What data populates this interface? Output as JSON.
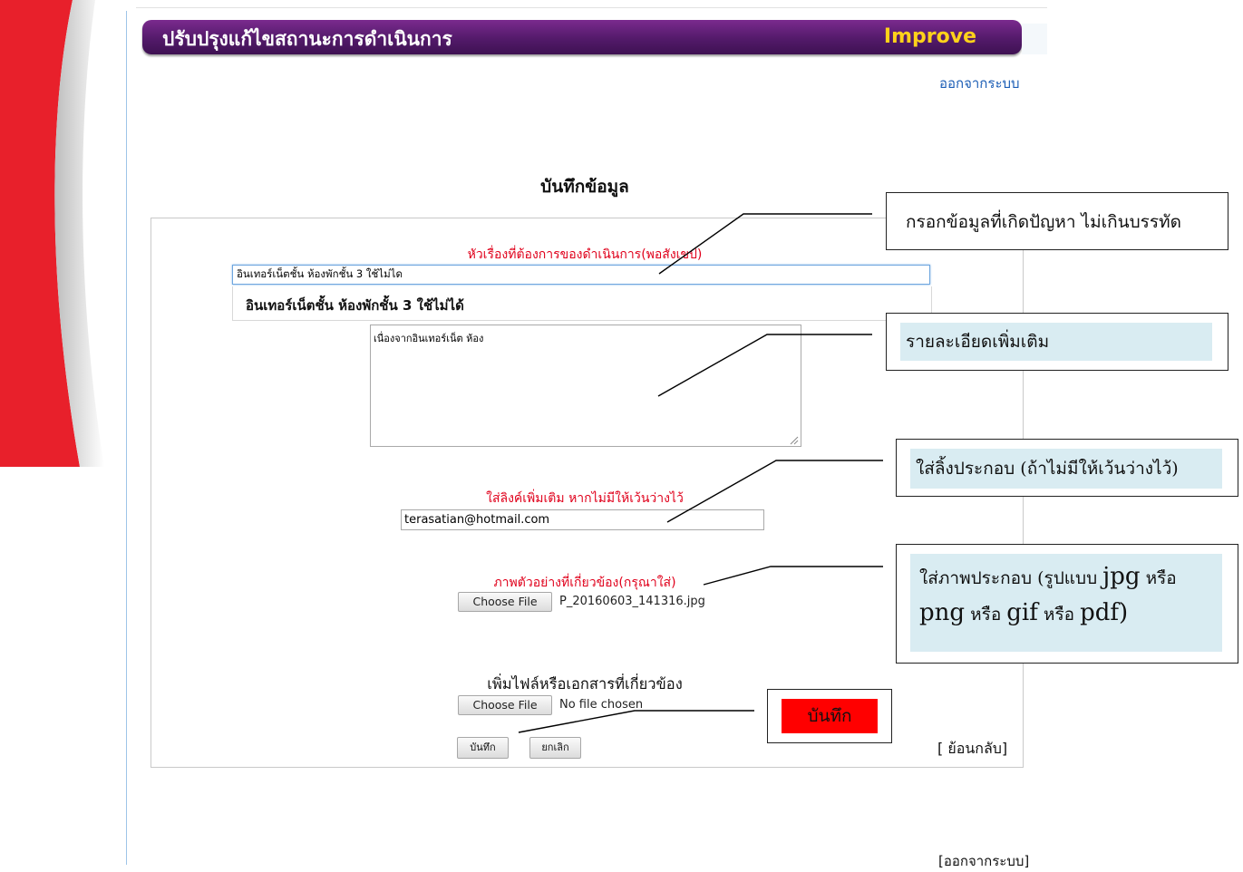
{
  "header": {
    "title_th": "ปรับปรุงแก้ไขสถานะการดำเนินการ",
    "title_en": "Improve",
    "logout_top": "ออกจากระบบ"
  },
  "form": {
    "heading": "บันทึกข้อมูล",
    "subject_label": "หัวเรื่องที่ต้องการของดำเนินการ(พอสังเขป)",
    "subject_value": "อินเทอร์เน็ตชั้น ห้องพักชั้น 3 ใช้ไม่ได",
    "subject_suggestion": "อินเทอร์เน็ตชั้น ห้องพักชั้น 3 ใช้ไม่ได้",
    "detail_value": "เนื่องจากอินเทอร์เน็ต ห้อง",
    "link_label": "ใส่ลิงค์เพิ่มเติม หากไม่มีให้เว้นว่างไว้",
    "link_value": "terasatian@hotmail.com",
    "image_label": "ภาพตัวอย่างที่เกี่ยวข้อง(กรุณาใส่)",
    "image_button": "Choose File",
    "image_filename": "P_20160603_141316.jpg",
    "attach_label": "เพิ่มไฟล์หรือเอกสารที่เกี่ยวข้อง",
    "attach_button": "Choose File",
    "attach_filename": "No file chosen",
    "save_label": "บันทึก",
    "cancel_label": "ยกเลิก",
    "back_label": "[ ย้อนกลับ]"
  },
  "footer": {
    "logout_bottom": "[ออกจากระบบ]"
  },
  "callouts": {
    "subject": "กรอกข้อมูลที่เกิดปัญหา ไม่เกินบรรทัด",
    "detail": "รายละเอียดเพิ่มเติม",
    "link": "ใส่ลิ้งประกอบ (ถ้าไม่มีให้เว้นว่างไว้)",
    "image_part1": "ใส่ภาพประกอบ (รูปแบบ",
    "image_jpg": "jpg",
    "image_part2": "หรือ",
    "image_png": "png",
    "image_part3": "หรือ",
    "image_gif": "gif",
    "image_part4": "หรือ",
    "image_pdf": "pdf)",
    "save": "บันทึก"
  },
  "colors": {
    "title_bar": "#531a6a",
    "title_en": "#ffd21a",
    "required_label": "#e0001b",
    "link": "#1b5db5",
    "callout_fill": "#d9ecf2",
    "save_callout_fill": "#ff0000"
  }
}
